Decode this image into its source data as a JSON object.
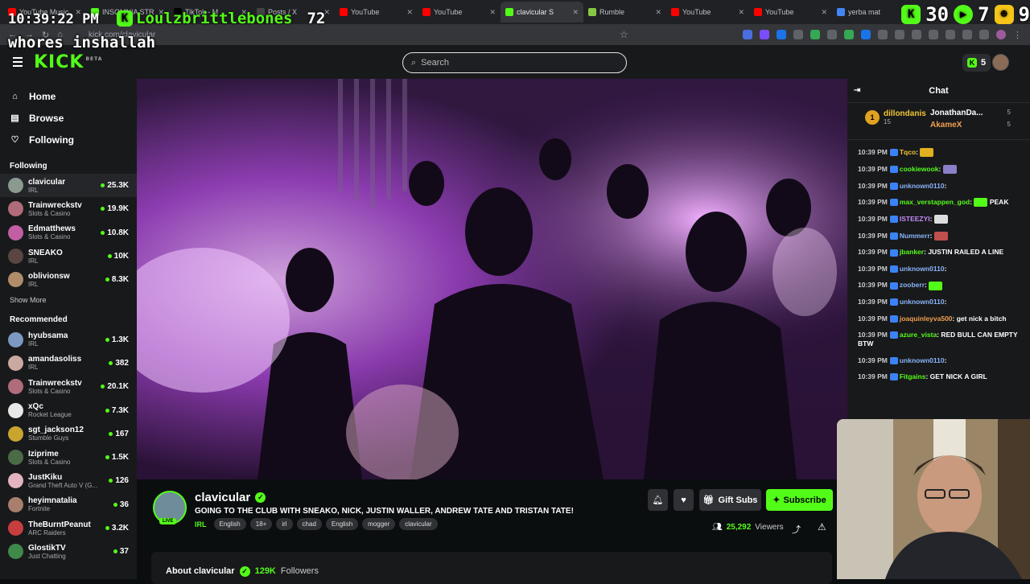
{
  "browser": {
    "tabs": [
      {
        "title": "YouTube Music",
        "color": "#ff0000"
      },
      {
        "title": "INSOMNIA STR",
        "color": "#53fc18"
      },
      {
        "title": "TikTok - M",
        "color": "#000000"
      },
      {
        "title": "Posts / X",
        "color": "#444444"
      },
      {
        "title": "YouTube",
        "color": "#ff0000"
      },
      {
        "title": "YouTube",
        "color": "#ff0000"
      },
      {
        "title": "clavicular S",
        "color": "#53fc18",
        "active": true
      },
      {
        "title": "Rumble",
        "color": "#85c742"
      },
      {
        "title": "YouTube",
        "color": "#ff0000"
      },
      {
        "title": "YouTube",
        "color": "#ff0000"
      },
      {
        "title": "yerba mat",
        "color": "#4285f4"
      }
    ],
    "url": "kick.com/clavicular"
  },
  "overlay": {
    "clock": "10:39:22 PM",
    "username": "Loulzbrittlebones",
    "count": "72",
    "message": "whores inshallah",
    "right_values": [
      "30",
      "7",
      "9"
    ]
  },
  "header": {
    "logo": "KICK",
    "logo_tag": "BETA",
    "search_placeholder": "Search",
    "points": "5"
  },
  "sidebar": {
    "nav": [
      {
        "label": "Home",
        "icon": "home-icon"
      },
      {
        "label": "Browse",
        "icon": "browse-icon"
      },
      {
        "label": "Following",
        "icon": "heart-icon"
      }
    ],
    "following_title": "Following",
    "following": [
      {
        "name": "clavicular",
        "category": "IRL",
        "viewers": "25.3K",
        "color": "#8a9a8f",
        "active": true
      },
      {
        "name": "Trainwreckstv",
        "category": "Slots & Casino",
        "viewers": "19.9K",
        "color": "#b06c7a"
      },
      {
        "name": "Edmatthews",
        "category": "Slots & Casino",
        "viewers": "10.8K",
        "color": "#c25fa4"
      },
      {
        "name": "SNEAKO",
        "category": "IRL",
        "viewers": "10K",
        "color": "#5a4640"
      },
      {
        "name": "oblivionsw",
        "category": "IRL",
        "viewers": "8.3K",
        "color": "#b08d6a"
      }
    ],
    "show_more": "Show More",
    "recommended_title": "Recommended",
    "recommended": [
      {
        "name": "hyubsama",
        "category": "IRL",
        "viewers": "1.3K",
        "color": "#7d98c2"
      },
      {
        "name": "amandasoliss",
        "category": "IRL",
        "viewers": "382",
        "color": "#c9a9a0"
      },
      {
        "name": "Trainwreckstv",
        "category": "Slots & Casino",
        "viewers": "20.1K",
        "color": "#b06c7a"
      },
      {
        "name": "xQc",
        "category": "Rocket League",
        "viewers": "7.3K",
        "color": "#e8e8e8"
      },
      {
        "name": "sgt_jackson12",
        "category": "Stumble Guys",
        "viewers": "167",
        "color": "#c9a530"
      },
      {
        "name": "Iziprime",
        "category": "Slots & Casino",
        "viewers": "1.5K",
        "color": "#4b6b47"
      },
      {
        "name": "JustKiku",
        "category": "Grand Theft Auto V (G...",
        "viewers": "126",
        "color": "#e4b3c2"
      },
      {
        "name": "heyimnatalia",
        "category": "Fortnite",
        "viewers": "36",
        "color": "#a87f6d"
      },
      {
        "name": "TheBurntPeanut",
        "category": "ARC Raiders",
        "viewers": "3.2K",
        "color": "#c73e3e"
      },
      {
        "name": "GlostikTV",
        "category": "Just Chatting",
        "viewers": "37",
        "color": "#3f8a4a"
      }
    ]
  },
  "stream": {
    "channel": "clavicular",
    "live_label": "LIVE",
    "title": "GOING TO THE CLUB WITH SNEAKO, NICK, JUSTIN WALLER, ANDREW TATE AND TRISTAN TATE!",
    "category": "IRL",
    "tags": [
      "English",
      "18+",
      "irl",
      "chad",
      "English",
      "mogger",
      "clavicular"
    ],
    "gift_label": "Gift Subs",
    "subscribe_label": "Subscribe",
    "viewers": "25,292",
    "viewers_label": "Viewers",
    "about_label": "About clavicular",
    "followers": "129K",
    "followers_label": "Followers"
  },
  "chat": {
    "title": "Chat",
    "leader_top": {
      "rank": "1",
      "name": "dillondanis",
      "points": "15"
    },
    "leaders": [
      {
        "name": "JonathanDa...",
        "points": "5",
        "color": "#ffffff"
      },
      {
        "name": "AkameX",
        "points": "5",
        "color": "#f0a050"
      }
    ],
    "messages": [
      {
        "time": "10:39 PM",
        "user": "Tqco",
        "color": "#f3c634",
        "text": "",
        "emote": "#e0b020"
      },
      {
        "time": "10:39 PM",
        "user": "cookiewook",
        "color": "#53fc18",
        "text": "",
        "emote": "#8a7fc9"
      },
      {
        "time": "10:39 PM",
        "user": "unknown0110",
        "color": "#8ab4f8",
        "text": ""
      },
      {
        "time": "10:39 PM",
        "user": "max_verstappen_god",
        "color": "#53fc18",
        "text": "PEAK",
        "emote": "#53fc18"
      },
      {
        "time": "10:39 PM",
        "user": "ISTEEZYI",
        "color": "#c58af9",
        "text": "",
        "emote": "#dddddd"
      },
      {
        "time": "10:39 PM",
        "user": "Nummerr",
        "color": "#8ab4f8",
        "text": "",
        "emote": "#c0504d"
      },
      {
        "time": "10:39 PM",
        "user": "jbanker",
        "color": "#53fc18",
        "text": "JUSTIN RAILED A LINE"
      },
      {
        "time": "10:39 PM",
        "user": "unknown0110",
        "color": "#8ab4f8",
        "text": ""
      },
      {
        "time": "10:39 PM",
        "user": "zooberr",
        "color": "#8ab4f8",
        "text": "",
        "emote": "#53fc18"
      },
      {
        "time": "10:39 PM",
        "user": "unknown0110",
        "color": "#8ab4f8",
        "text": ""
      },
      {
        "time": "10:39 PM",
        "user": "joaquinleyva500",
        "color": "#f0a050",
        "text": "get nick a bitch"
      },
      {
        "time": "10:39 PM",
        "user": "azure_vista",
        "color": "#53fc18",
        "text": "RED BULL CAN EMPTY BTW"
      },
      {
        "time": "10:39 PM",
        "user": "unknown0110",
        "color": "#8ab4f8",
        "text": ""
      },
      {
        "time": "10:39 PM",
        "user": "Fitgains",
        "color": "#53fc18",
        "text": "GET NICK A GIRL"
      }
    ]
  }
}
